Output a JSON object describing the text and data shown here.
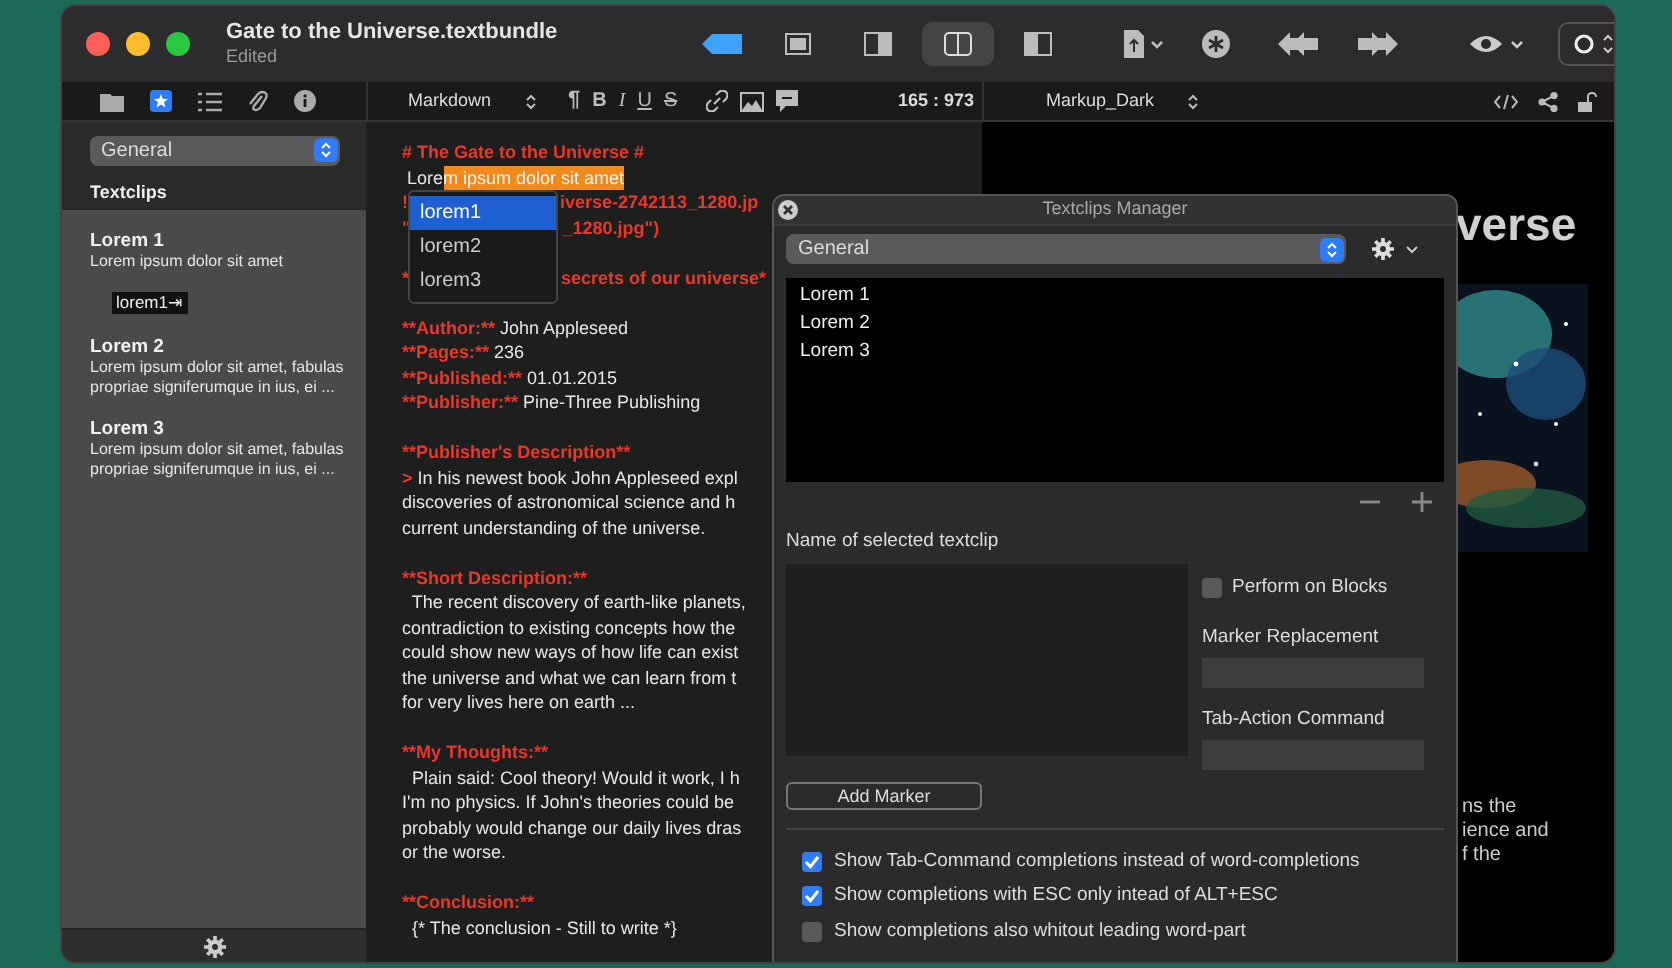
{
  "window": {
    "title": "Gate to the Universe.textbundle",
    "subtitle": "Edited"
  },
  "view_modes": [
    {
      "selected": false
    },
    {
      "selected": false
    },
    {
      "selected": true
    },
    {
      "selected": false
    }
  ],
  "format_bar": {
    "syntax": "Markdown",
    "format_buttons": [
      "¶",
      "B",
      "I",
      "U",
      "S"
    ],
    "position": "165 : 973",
    "theme": "Markup_Dark"
  },
  "sidebar": {
    "group": "General",
    "header": "Textclips",
    "items": [
      {
        "title": "Lorem 1",
        "text": "Lorem ipsum dolor sit amet",
        "shortcut": "lorem1⇥"
      },
      {
        "title": "Lorem 2",
        "text": "Lorem ipsum dolor sit amet, fabulas propriae signiferumque in ius, ei  ..."
      },
      {
        "title": "Lorem 3",
        "text": "Lorem ipsum dolor sit amet, fabulas propriae signiferumque in ius, ei  ..."
      }
    ]
  },
  "editor": {
    "lines": [
      {
        "kind": "line",
        "segments": [
          {
            "kind": "markup",
            "text": "# The Gate to the Universe #"
          }
        ]
      },
      {
        "kind": "line",
        "segments": [
          {
            "kind": "text",
            "text": " Lore"
          },
          {
            "kind": "highlight",
            "text": "m ipsum dolor sit amet"
          }
        ]
      },
      {
        "kind": "line",
        "segments": [
          {
            "kind": "markup",
            "text": "!"
          },
          {
            "kind": "gap"
          },
          {
            "kind": "markup",
            "text": "iverse-2742113_1280.jp"
          }
        ]
      },
      {
        "kind": "line",
        "segments": [
          {
            "kind": "markup",
            "text": "\""
          },
          {
            "kind": "gap"
          },
          {
            "kind": "markup",
            "text": "_1280.jpg\")"
          }
        ]
      },
      {
        "kind": "blank"
      },
      {
        "kind": "line",
        "segments": [
          {
            "kind": "markup",
            "text": "*"
          },
          {
            "kind": "gap"
          },
          {
            "kind": "markup",
            "text": "secrets of our universe*"
          }
        ]
      },
      {
        "kind": "blank"
      },
      {
        "kind": "line",
        "segments": [
          {
            "kind": "markup",
            "text": "**Author:**"
          },
          {
            "kind": "text",
            "text": " John Appleseed"
          }
        ]
      },
      {
        "kind": "line",
        "segments": [
          {
            "kind": "markup",
            "text": "**Pages:**"
          },
          {
            "kind": "text",
            "text": " 236"
          }
        ]
      },
      {
        "kind": "line",
        "segments": [
          {
            "kind": "markup",
            "text": "**Published:**"
          },
          {
            "kind": "text",
            "text": " 01.01.2015"
          }
        ]
      },
      {
        "kind": "line",
        "segments": [
          {
            "kind": "markup",
            "text": "**Publisher:**"
          },
          {
            "kind": "text",
            "text": " Pine-Three Publishing"
          }
        ]
      },
      {
        "kind": "blank"
      },
      {
        "kind": "line",
        "segments": [
          {
            "kind": "markup",
            "text": "**Publisher's Description**"
          }
        ]
      },
      {
        "kind": "line",
        "segments": [
          {
            "kind": "markup",
            "text": ">"
          },
          {
            "kind": "text",
            "text": " In his newest book John Appleseed expl"
          }
        ]
      },
      {
        "kind": "line",
        "segments": [
          {
            "kind": "text",
            "text": "discoveries of astronomical science and h"
          }
        ]
      },
      {
        "kind": "line",
        "segments": [
          {
            "kind": "text",
            "text": "current understanding of the universe."
          }
        ]
      },
      {
        "kind": "blank"
      },
      {
        "kind": "line",
        "segments": [
          {
            "kind": "markup",
            "text": "**Short Description:**"
          }
        ]
      },
      {
        "kind": "line",
        "segments": [
          {
            "kind": "text",
            "text": "  The recent discovery of earth-like planets,"
          }
        ]
      },
      {
        "kind": "line",
        "segments": [
          {
            "kind": "text",
            "text": "contradiction to existing concepts how the"
          }
        ]
      },
      {
        "kind": "line",
        "segments": [
          {
            "kind": "text",
            "text": "could show new ways of how life can exist"
          }
        ]
      },
      {
        "kind": "line",
        "segments": [
          {
            "kind": "text",
            "text": "the universe and what we can learn from t"
          }
        ]
      },
      {
        "kind": "line",
        "segments": [
          {
            "kind": "text",
            "text": "for very lives here on earth ..."
          }
        ]
      },
      {
        "kind": "blank"
      },
      {
        "kind": "line",
        "segments": [
          {
            "kind": "markup",
            "text": "**My Thoughts:**"
          }
        ]
      },
      {
        "kind": "line",
        "segments": [
          {
            "kind": "text",
            "text": "  Plain said: Cool theory! Would it work, I h"
          }
        ]
      },
      {
        "kind": "line",
        "segments": [
          {
            "kind": "text",
            "text": "I'm no physics. If John's theories could be"
          }
        ]
      },
      {
        "kind": "line",
        "segments": [
          {
            "kind": "text",
            "text": "probably would change our daily lives dras"
          }
        ]
      },
      {
        "kind": "line",
        "segments": [
          {
            "kind": "text",
            "text": "or the worse."
          }
        ]
      },
      {
        "kind": "blank"
      },
      {
        "kind": "line",
        "segments": [
          {
            "kind": "markup",
            "text": "**Conclusion:**"
          }
        ]
      },
      {
        "kind": "line",
        "segments": [
          {
            "kind": "text",
            "text": "  {* The conclusion - Still to write *}"
          }
        ]
      }
    ],
    "completion": [
      {
        "label": "lorem1",
        "selected": true
      },
      {
        "label": "lorem2",
        "selected": false
      },
      {
        "label": "lorem3",
        "selected": false
      }
    ]
  },
  "preview": {
    "title": "verse",
    "lines": [
      "ns the",
      "ience and",
      "f the"
    ]
  },
  "manager": {
    "title": "Textclips Manager",
    "group": "General",
    "clips": [
      "Lorem 1",
      "Lorem 2",
      "Lorem 3"
    ],
    "name_label": "Name of selected textclip",
    "perform_on_blocks": {
      "label": "Perform on Blocks",
      "checked": false
    },
    "marker_replacement_label": "Marker Replacement",
    "tab_action_label": "Tab-Action Command",
    "add_marker": "Add Marker",
    "options": [
      {
        "label": "Show Tab-Command completions instead of word-completions",
        "checked": true
      },
      {
        "label": "Show completions with ESC only intead of ALT+ESC",
        "checked": true
      },
      {
        "label": "Show completions also whitout leading word-part",
        "checked": false
      }
    ]
  }
}
